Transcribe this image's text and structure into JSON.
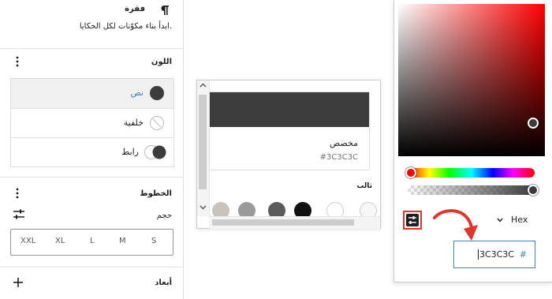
{
  "block": {
    "title": "فقرة",
    "description": "ابدأ بناء مكوّنات لكل الحكايا.",
    "icon": "paragraph-icon"
  },
  "color_panel": {
    "title": "اللون",
    "options_icon": "more-vertical-icon",
    "items": [
      {
        "label": "نص",
        "swatch": "#3c3c3c",
        "selected": true
      },
      {
        "label": "خلفية",
        "swatch": "none"
      },
      {
        "label": "رابط",
        "swatch": "#3c3c3c"
      }
    ]
  },
  "typography_panel": {
    "title": "الخطوط",
    "options_icon": "more-vertical-icon",
    "size_label": "حجم",
    "size_options": [
      "XXL",
      "XL",
      "L",
      "M",
      "S"
    ],
    "settings_icon": "sliders-icon"
  },
  "dimensions_panel": {
    "title": "أبعاد",
    "add_icon": "plus-icon"
  },
  "palette_popover": {
    "custom_label": "مخصص",
    "custom_value": "#3C3C3C",
    "section_label": "ثالب",
    "swatches": [
      "#f7f7f7",
      "#ffffff",
      "#111111",
      "#5a5a5a",
      "#9a9a9a",
      "#c8c4bc"
    ]
  },
  "color_picker": {
    "format": "Hex",
    "hex_prefix": "#",
    "hex_value": "3C3C3C",
    "accent": "#3a83c4",
    "highlight": "#e0352b"
  }
}
